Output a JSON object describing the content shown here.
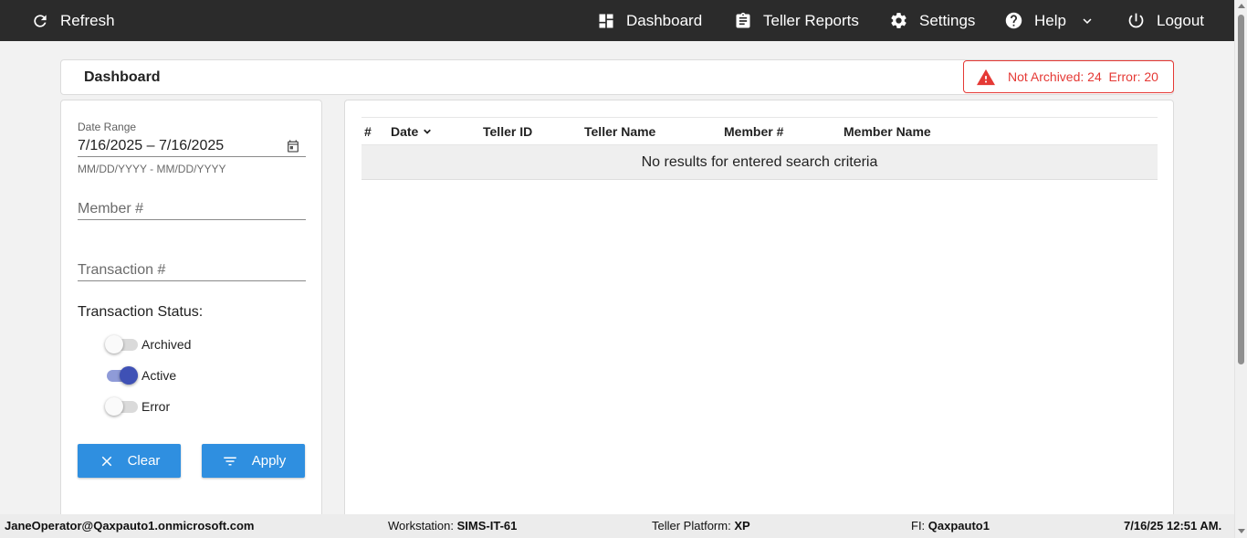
{
  "navbar": {
    "refresh_label": "Refresh",
    "dashboard_label": "Dashboard",
    "teller_reports_label": "Teller Reports",
    "settings_label": "Settings",
    "help_label": "Help",
    "logout_label": "Logout"
  },
  "title_card": {
    "title": "Dashboard",
    "alert_text": "Not Archived: 24  Error: 20",
    "alert_color": "#e53935"
  },
  "filters": {
    "date_range_label": "Date Range",
    "date_range_value": "7/16/2025 – 7/16/2025",
    "date_range_hint": "MM/DD/YYYY - MM/DD/YYYY",
    "member_placeholder": "Member #",
    "transaction_placeholder": "Transaction #",
    "status_label": "Transaction Status:",
    "statuses": [
      {
        "label": "Archived",
        "on": false
      },
      {
        "label": "Active",
        "on": true
      },
      {
        "label": "Error",
        "on": false
      }
    ],
    "clear_label": "Clear",
    "apply_label": "Apply"
  },
  "table": {
    "columns": [
      "#",
      "Date",
      "Teller ID",
      "Teller Name",
      "Member #",
      "Member Name"
    ],
    "empty_message": "No results for entered search criteria"
  },
  "statusbar": {
    "user": "JaneOperator@Qaxpauto1.onmicrosoft.com",
    "workstation_label": "Workstation:",
    "workstation_value": "SIMS-IT-61",
    "platform_label": "Teller Platform:",
    "platform_value": "XP",
    "fi_label": "FI:",
    "fi_value": "Qaxpauto1",
    "datetime": "7/16/25 12:51 AM."
  },
  "colors": {
    "navbar_bg": "#2b2b2b",
    "primary_button": "#2f8fe0",
    "toggle_on": "#3f51b5"
  }
}
